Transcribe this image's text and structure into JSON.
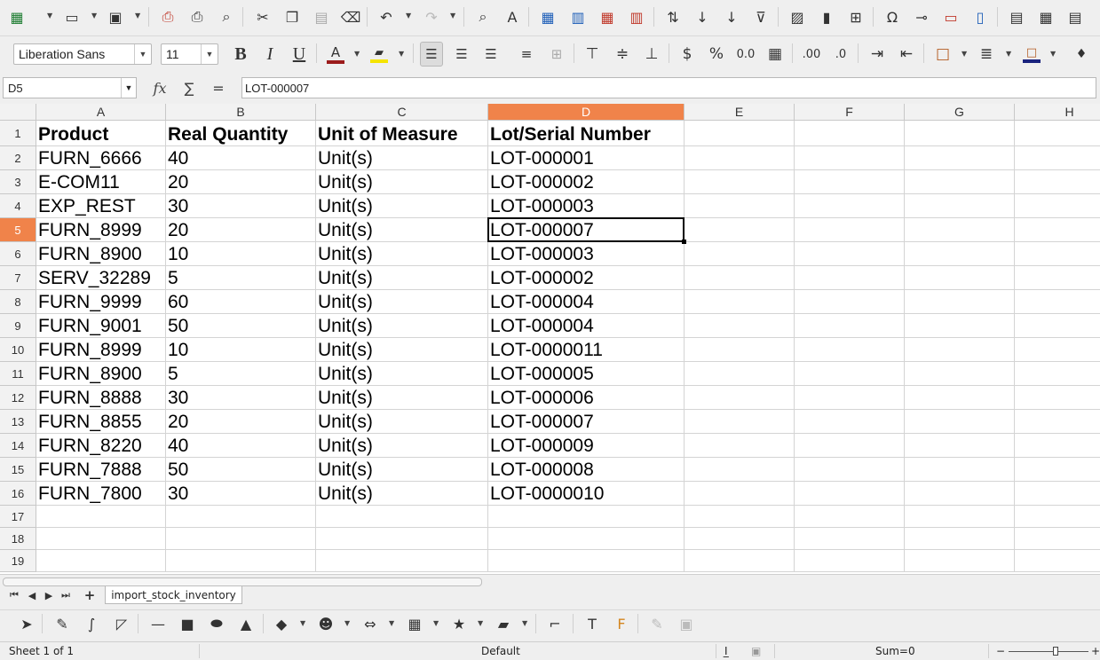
{
  "toolbar": {
    "font_name": "Liberation Sans",
    "font_size": "11",
    "icons": [
      "grid-icon",
      "open-folder-icon",
      "save-icon",
      "pdf-export-icon",
      "print-icon",
      "print-preview-icon",
      "cut-icon",
      "copy-icon",
      "paste-icon",
      "clone-format-icon",
      "undo-icon",
      "redo-icon",
      "find-icon",
      "spellcheck-icon",
      "row-icon",
      "column-icon",
      "delete-row-icon",
      "delete-column-icon",
      "sort-icon",
      "sort-ascending-icon",
      "sort-descending-icon",
      "autofilter-icon",
      "image-icon",
      "chart-icon",
      "pivot-table-icon",
      "special-character-icon",
      "hyperlink-icon",
      "comment-icon",
      "header-footer-icon",
      "define-print-area-icon",
      "freeze-icon",
      "split-icon"
    ]
  },
  "formula_bar": {
    "cell_ref": "D5",
    "function_wizard": "fx",
    "sum": "∑",
    "equals": "=",
    "content": "LOT-000007"
  },
  "sheet": {
    "columns": [
      "A",
      "B",
      "C",
      "D",
      "E",
      "F",
      "G",
      "H"
    ],
    "rows": [
      "1",
      "2",
      "3",
      "4",
      "5",
      "6",
      "7",
      "8",
      "9",
      "10",
      "11",
      "12",
      "13",
      "14",
      "15",
      "16",
      "17",
      "18",
      "19"
    ],
    "header": [
      "Product",
      "Real Quantity",
      "Unit of Measure",
      "Lot/Serial Number"
    ],
    "data": [
      [
        "FURN_6666",
        "40",
        "Unit(s)",
        "LOT-000001"
      ],
      [
        "E-COM11",
        "20",
        "Unit(s)",
        "LOT-000002"
      ],
      [
        "EXP_REST",
        "30",
        "Unit(s)",
        "LOT-000003"
      ],
      [
        "FURN_8999",
        "20",
        "Unit(s)",
        "LOT-000007"
      ],
      [
        "FURN_8900",
        "10",
        "Unit(s)",
        "LOT-000003"
      ],
      [
        "SERV_32289",
        "5",
        "Unit(s)",
        "LOT-000002"
      ],
      [
        "FURN_9999",
        "60",
        "Unit(s)",
        "LOT-000004"
      ],
      [
        "FURN_9001",
        "50",
        "Unit(s)",
        "LOT-000004"
      ],
      [
        "FURN_8999",
        "10",
        "Unit(s)",
        "LOT-0000011"
      ],
      [
        "FURN_8900",
        "5",
        "Unit(s)",
        "LOT-000005"
      ],
      [
        "FURN_8888",
        "30",
        "Unit(s)",
        "LOT-000006"
      ],
      [
        "FURN_8855",
        "20",
        "Unit(s)",
        "LOT-000007"
      ],
      [
        "FURN_8220",
        "40",
        "Unit(s)",
        "LOT-000009"
      ],
      [
        "FURN_7888",
        "50",
        "Unit(s)",
        "LOT-000008"
      ],
      [
        "FURN_7800",
        "30",
        "Unit(s)",
        "LOT-0000010"
      ]
    ],
    "selected_column": "D",
    "selected_row": "5"
  },
  "sheet_tabs": {
    "active": "import_stock_inventory"
  },
  "status_bar": {
    "sheet_info": "Sheet 1 of 1",
    "page_style": "Default",
    "sum": "Sum=0",
    "zoom_minus": "−",
    "zoom_plus": "+"
  },
  "colors": {
    "selection_header": "#f0834a",
    "font_color": "#c0392b",
    "highlight_color": "#f5e400",
    "border_color": "#1a237e"
  }
}
